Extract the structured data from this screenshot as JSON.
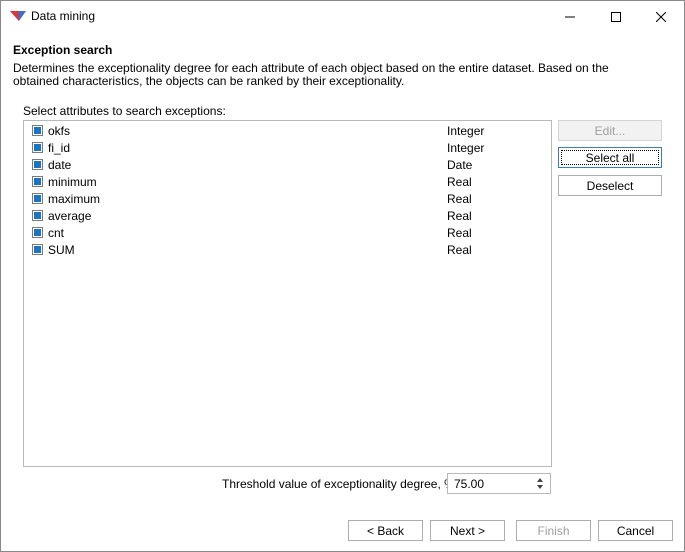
{
  "window": {
    "title": "Data mining",
    "controls": [
      "minimize",
      "maximize",
      "close"
    ]
  },
  "page": {
    "section_title": "Exception search",
    "description": "Determines the exceptionality degree for each attribute of each object based on the entire dataset. Based on the obtained characteristics, the objects can be ranked by their exceptionality.",
    "list_label": "Select attributes to search exceptions:"
  },
  "attributes": [
    {
      "name": "okfs",
      "type": "Integer",
      "checked": true
    },
    {
      "name": "fi_id",
      "type": "Integer",
      "checked": true
    },
    {
      "name": "date",
      "type": "Date",
      "checked": true
    },
    {
      "name": "minimum",
      "type": "Real",
      "checked": true
    },
    {
      "name": "maximum",
      "type": "Real",
      "checked": true
    },
    {
      "name": "average",
      "type": "Real",
      "checked": true
    },
    {
      "name": "cnt",
      "type": "Real",
      "checked": true
    },
    {
      "name": "SUM",
      "type": "Real",
      "checked": true
    }
  ],
  "side_buttons": {
    "edit": "Edit...",
    "select_all": "Select all",
    "deselect": "Deselect"
  },
  "threshold": {
    "label": "Threshold value of exceptionality degree, %:",
    "value": "75.00"
  },
  "footer": {
    "back": "< Back",
    "next": "Next >",
    "finish": "Finish",
    "cancel": "Cancel"
  },
  "colors": {
    "checkbox_fill": "#1a73c4",
    "app_icon_blue": "#3a6fd8",
    "app_icon_red": "#d9383a"
  }
}
